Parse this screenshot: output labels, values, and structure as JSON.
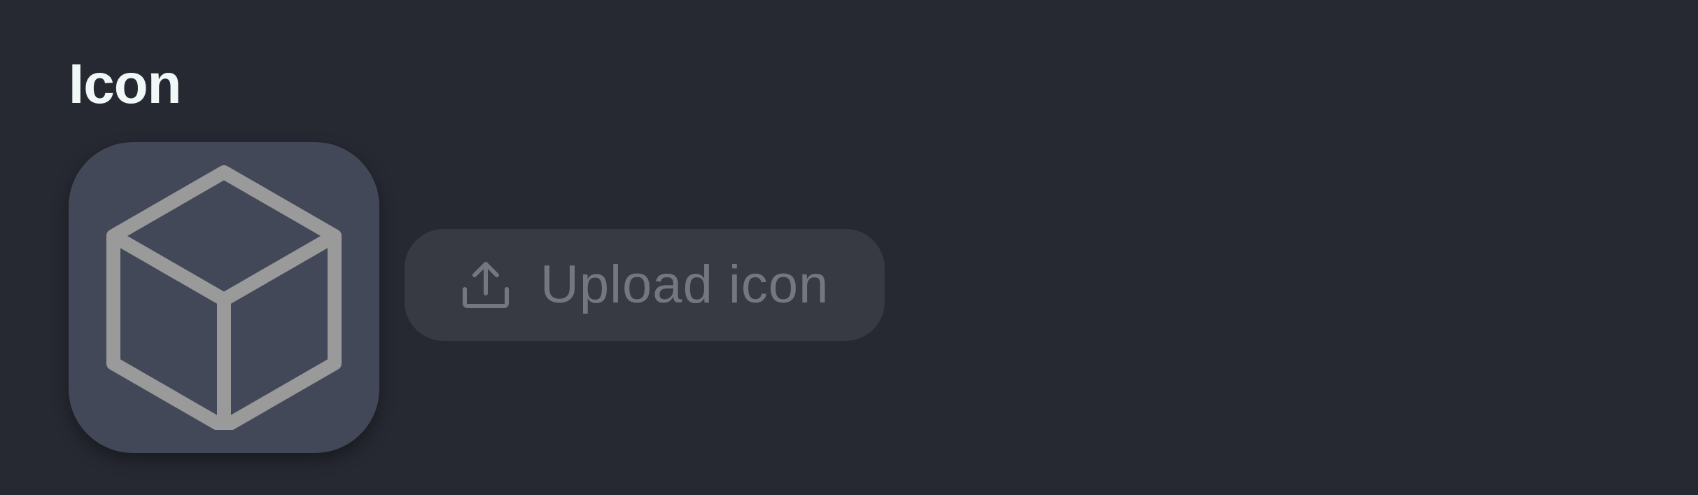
{
  "section": {
    "title": "Icon"
  },
  "icon_preview": {
    "icon": "cube-icon"
  },
  "upload": {
    "label": "Upload icon",
    "icon": "upload-icon"
  },
  "colors": {
    "background": "#262932",
    "title_text": "#f0f8f8",
    "preview_tile": "#434858",
    "preview_glyph": "#9a9a9a",
    "button_background": "#373a43",
    "button_text": "#74777f"
  }
}
